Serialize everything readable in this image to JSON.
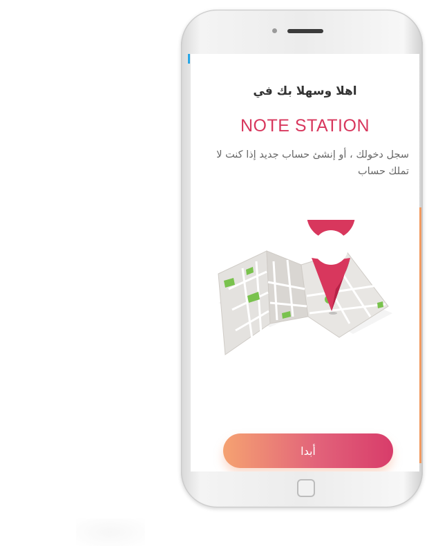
{
  "welcome": {
    "heading": "اهلا وسهلا بك في",
    "brand": "NOTE STATION",
    "subtitle": "سجل دخولك ، أو إنشئ حساب جديد إذا كنت لا تملك حساب"
  },
  "actions": {
    "start_label": "أبدا"
  },
  "illustration": {
    "icon": "map-with-location-pin",
    "pin_color": "#d8375d",
    "map_color": "#e8e6e3",
    "park_color": "#79c24d"
  },
  "colors": {
    "accent": "#d8375d",
    "gradient_start": "#f5a271",
    "gradient_end": "#d83c6a"
  }
}
